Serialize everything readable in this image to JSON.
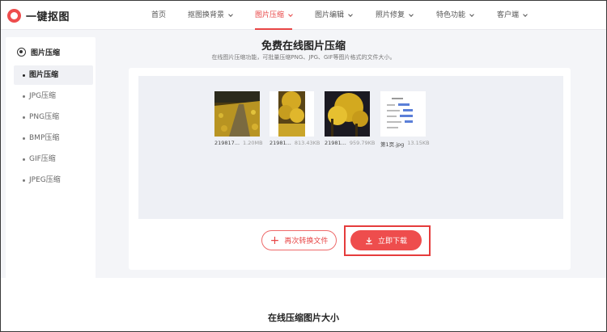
{
  "header": {
    "logo_text": "一键抠图",
    "nav": [
      {
        "label": "首页",
        "has_chevron": false,
        "active": false
      },
      {
        "label": "抠图换背景",
        "has_chevron": true,
        "active": false
      },
      {
        "label": "图片压缩",
        "has_chevron": true,
        "active": true
      },
      {
        "label": "图片编辑",
        "has_chevron": true,
        "active": false
      },
      {
        "label": "照片修复",
        "has_chevron": true,
        "active": false
      },
      {
        "label": "特色功能",
        "has_chevron": true,
        "active": false
      },
      {
        "label": "客户端",
        "has_chevron": true,
        "active": false
      }
    ],
    "accent_color": "#e84545"
  },
  "sidebar": {
    "heading": "图片压缩",
    "items": [
      {
        "label": "图片压缩",
        "active": true
      },
      {
        "label": "JPG压缩",
        "active": false
      },
      {
        "label": "PNG压缩",
        "active": false
      },
      {
        "label": "BMP压缩",
        "active": false
      },
      {
        "label": "GIF压缩",
        "active": false
      },
      {
        "label": "JPEG压缩",
        "active": false
      }
    ]
  },
  "main": {
    "title": "免费在线图片压缩",
    "subtitle": "在线图片压缩功能，可批量压缩PNG、JPG、GIF等图片格式的文件大小。",
    "files": [
      {
        "name": "219817...",
        "size": "1.20MB",
        "icon": "ginkgo-road-photo"
      },
      {
        "name": "21981...",
        "size": "813.43KB",
        "icon": "ginkgo-tree-photo"
      },
      {
        "name": "21981...",
        "size": "959.79KB",
        "icon": "ginkgo-night-photo"
      },
      {
        "name": "第1页.jpg",
        "size": "13.15KB",
        "icon": "document-page-thumbnail"
      }
    ],
    "convert_again_label": "再次转换文件",
    "download_label": "立即下载"
  },
  "section": {
    "title": "在线压缩图片大小"
  }
}
